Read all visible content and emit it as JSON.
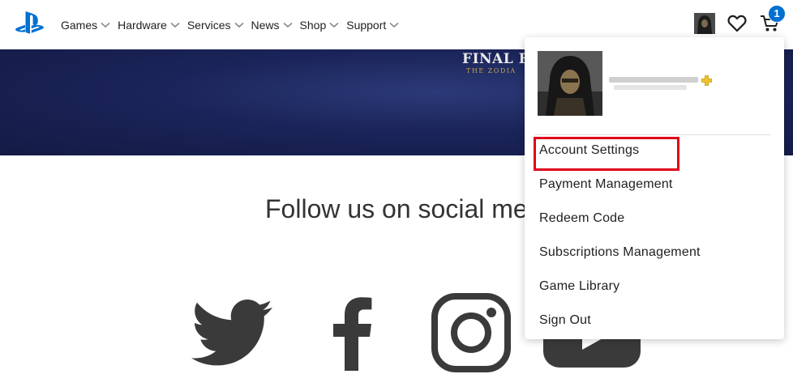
{
  "nav": {
    "items": [
      {
        "label": "Games"
      },
      {
        "label": "Hardware"
      },
      {
        "label": "Services"
      },
      {
        "label": "News"
      },
      {
        "label": "Shop"
      },
      {
        "label": "Support"
      }
    ]
  },
  "header_icons": {
    "avatar": "user-avatar",
    "wishlist": "heart-icon",
    "cart": "cart-icon",
    "cart_count": "1",
    "accent_color": "#0070d1"
  },
  "banner": {
    "title": "FINAL FAN",
    "subtitle": "THE ZODIA"
  },
  "social": {
    "heading": "Follow us on social me",
    "icons": [
      "twitter-icon",
      "facebook-icon",
      "instagram-icon",
      "youtube-icon"
    ]
  },
  "account_menu": {
    "highlight_color": "#e0001b",
    "items": [
      {
        "label": "Account Settings"
      },
      {
        "label": "Payment Management"
      },
      {
        "label": "Redeem Code"
      },
      {
        "label": "Subscriptions Management"
      },
      {
        "label": "Game Library"
      },
      {
        "label": "Sign Out"
      }
    ]
  }
}
